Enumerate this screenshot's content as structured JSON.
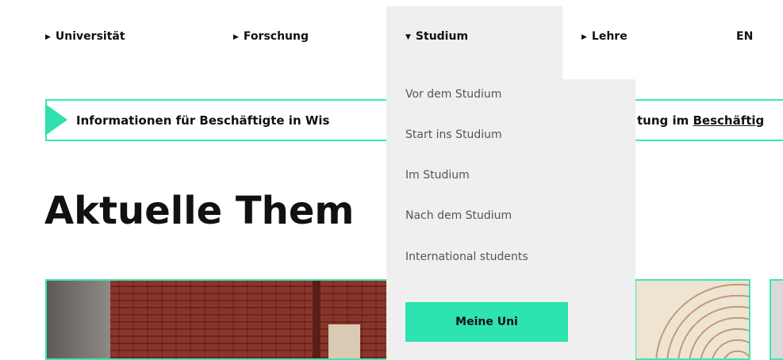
{
  "nav": {
    "items": [
      {
        "label": "Universität",
        "arrow": "▶"
      },
      {
        "label": "Forschung",
        "arrow": "▶"
      },
      {
        "label": "Studium",
        "arrow": "▼"
      },
      {
        "label": "Lehre",
        "arrow": "▶"
      }
    ],
    "language": "EN"
  },
  "banner": {
    "text_left": "Informationen für Beschäftigte in Wis",
    "text_right_prefix": "tung im ",
    "text_right_link": "Beschäftig"
  },
  "heading": "Aktuelle Them",
  "dropdown": {
    "items": [
      "Vor dem Studium",
      "Start ins Studium",
      "Im Studium",
      "Nach dem Studium",
      "International students"
    ],
    "button": "Meine Uni"
  },
  "colors": {
    "accent": "#2de3b0",
    "dropdown_bg": "#efefef",
    "text": "#111111"
  }
}
